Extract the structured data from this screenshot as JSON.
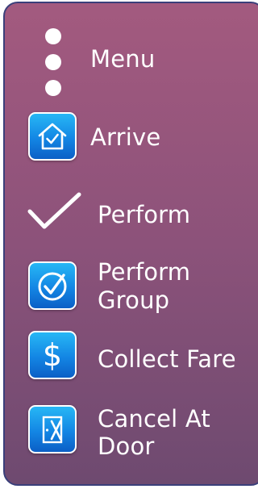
{
  "menu": {
    "items": [
      {
        "id": "menu",
        "label": "Menu",
        "icon": "more-vertical-icon"
      },
      {
        "id": "arrive",
        "label": "Arrive",
        "icon": "home-check-icon"
      },
      {
        "id": "perform",
        "label": "Perform",
        "icon": "checkmark-icon"
      },
      {
        "id": "perform_group",
        "label_line1": "Perform",
        "label_line2": "Group",
        "icon": "circle-check-icon"
      },
      {
        "id": "collect_fare",
        "label": "Collect Fare",
        "icon": "dollar-icon",
        "symbol": "$"
      },
      {
        "id": "cancel_at_door",
        "label_line1": "Cancel At",
        "label_line2": "Door",
        "icon": "door-cancel-icon"
      }
    ]
  },
  "colors": {
    "panel_top": "#a35a7f",
    "panel_bottom": "#6e4a70",
    "panel_border": "#3a3f7a",
    "icon_blue": "#1386e4",
    "text": "#ffffff"
  }
}
